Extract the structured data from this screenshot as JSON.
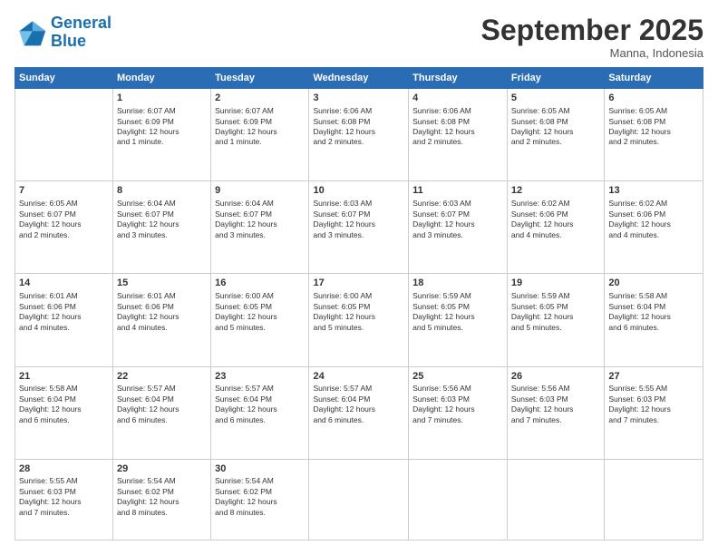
{
  "logo": {
    "line1": "General",
    "line2": "Blue"
  },
  "header": {
    "title": "September 2025",
    "subtitle": "Manna, Indonesia"
  },
  "weekdays": [
    "Sunday",
    "Monday",
    "Tuesday",
    "Wednesday",
    "Thursday",
    "Friday",
    "Saturday"
  ],
  "weeks": [
    [
      {
        "day": "",
        "info": ""
      },
      {
        "day": "1",
        "info": "Sunrise: 6:07 AM\nSunset: 6:09 PM\nDaylight: 12 hours\nand 1 minute."
      },
      {
        "day": "2",
        "info": "Sunrise: 6:07 AM\nSunset: 6:09 PM\nDaylight: 12 hours\nand 1 minute."
      },
      {
        "day": "3",
        "info": "Sunrise: 6:06 AM\nSunset: 6:08 PM\nDaylight: 12 hours\nand 2 minutes."
      },
      {
        "day": "4",
        "info": "Sunrise: 6:06 AM\nSunset: 6:08 PM\nDaylight: 12 hours\nand 2 minutes."
      },
      {
        "day": "5",
        "info": "Sunrise: 6:05 AM\nSunset: 6:08 PM\nDaylight: 12 hours\nand 2 minutes."
      },
      {
        "day": "6",
        "info": "Sunrise: 6:05 AM\nSunset: 6:08 PM\nDaylight: 12 hours\nand 2 minutes."
      }
    ],
    [
      {
        "day": "7",
        "info": "Sunrise: 6:05 AM\nSunset: 6:07 PM\nDaylight: 12 hours\nand 2 minutes."
      },
      {
        "day": "8",
        "info": "Sunrise: 6:04 AM\nSunset: 6:07 PM\nDaylight: 12 hours\nand 3 minutes."
      },
      {
        "day": "9",
        "info": "Sunrise: 6:04 AM\nSunset: 6:07 PM\nDaylight: 12 hours\nand 3 minutes."
      },
      {
        "day": "10",
        "info": "Sunrise: 6:03 AM\nSunset: 6:07 PM\nDaylight: 12 hours\nand 3 minutes."
      },
      {
        "day": "11",
        "info": "Sunrise: 6:03 AM\nSunset: 6:07 PM\nDaylight: 12 hours\nand 3 minutes."
      },
      {
        "day": "12",
        "info": "Sunrise: 6:02 AM\nSunset: 6:06 PM\nDaylight: 12 hours\nand 4 minutes."
      },
      {
        "day": "13",
        "info": "Sunrise: 6:02 AM\nSunset: 6:06 PM\nDaylight: 12 hours\nand 4 minutes."
      }
    ],
    [
      {
        "day": "14",
        "info": "Sunrise: 6:01 AM\nSunset: 6:06 PM\nDaylight: 12 hours\nand 4 minutes."
      },
      {
        "day": "15",
        "info": "Sunrise: 6:01 AM\nSunset: 6:06 PM\nDaylight: 12 hours\nand 4 minutes."
      },
      {
        "day": "16",
        "info": "Sunrise: 6:00 AM\nSunset: 6:05 PM\nDaylight: 12 hours\nand 5 minutes."
      },
      {
        "day": "17",
        "info": "Sunrise: 6:00 AM\nSunset: 6:05 PM\nDaylight: 12 hours\nand 5 minutes."
      },
      {
        "day": "18",
        "info": "Sunrise: 5:59 AM\nSunset: 6:05 PM\nDaylight: 12 hours\nand 5 minutes."
      },
      {
        "day": "19",
        "info": "Sunrise: 5:59 AM\nSunset: 6:05 PM\nDaylight: 12 hours\nand 5 minutes."
      },
      {
        "day": "20",
        "info": "Sunrise: 5:58 AM\nSunset: 6:04 PM\nDaylight: 12 hours\nand 6 minutes."
      }
    ],
    [
      {
        "day": "21",
        "info": "Sunrise: 5:58 AM\nSunset: 6:04 PM\nDaylight: 12 hours\nand 6 minutes."
      },
      {
        "day": "22",
        "info": "Sunrise: 5:57 AM\nSunset: 6:04 PM\nDaylight: 12 hours\nand 6 minutes."
      },
      {
        "day": "23",
        "info": "Sunrise: 5:57 AM\nSunset: 6:04 PM\nDaylight: 12 hours\nand 6 minutes."
      },
      {
        "day": "24",
        "info": "Sunrise: 5:57 AM\nSunset: 6:04 PM\nDaylight: 12 hours\nand 6 minutes."
      },
      {
        "day": "25",
        "info": "Sunrise: 5:56 AM\nSunset: 6:03 PM\nDaylight: 12 hours\nand 7 minutes."
      },
      {
        "day": "26",
        "info": "Sunrise: 5:56 AM\nSunset: 6:03 PM\nDaylight: 12 hours\nand 7 minutes."
      },
      {
        "day": "27",
        "info": "Sunrise: 5:55 AM\nSunset: 6:03 PM\nDaylight: 12 hours\nand 7 minutes."
      }
    ],
    [
      {
        "day": "28",
        "info": "Sunrise: 5:55 AM\nSunset: 6:03 PM\nDaylight: 12 hours\nand 7 minutes."
      },
      {
        "day": "29",
        "info": "Sunrise: 5:54 AM\nSunset: 6:02 PM\nDaylight: 12 hours\nand 8 minutes."
      },
      {
        "day": "30",
        "info": "Sunrise: 5:54 AM\nSunset: 6:02 PM\nDaylight: 12 hours\nand 8 minutes."
      },
      {
        "day": "",
        "info": ""
      },
      {
        "day": "",
        "info": ""
      },
      {
        "day": "",
        "info": ""
      },
      {
        "day": "",
        "info": ""
      }
    ]
  ]
}
